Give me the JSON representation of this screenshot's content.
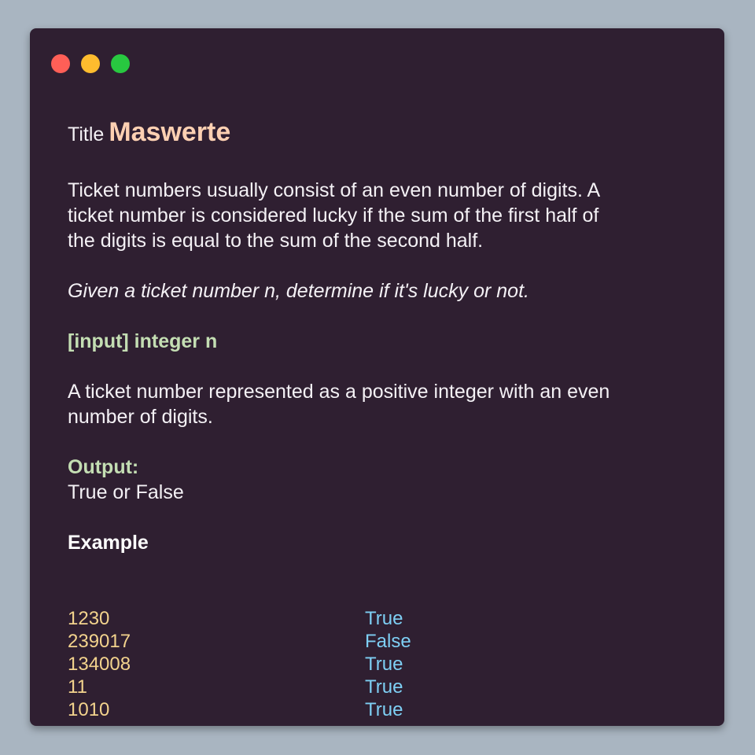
{
  "window": {
    "controls": {
      "close_color": "#ff5f57",
      "minimize_color": "#febc2e",
      "maximize_color": "#28c840"
    }
  },
  "content": {
    "title_prefix": "Title",
    "title_name": "Maswerte",
    "description": "Ticket numbers usually consist of an even number of digits. A ticket number is considered lucky if the sum of the first half of the digits is equal to the sum of the second half.",
    "task": "Given a ticket number n, determine if it's lucky or not.",
    "input_label": "[input] integer n",
    "input_description": "A ticket number represented as a positive integer with an even number of digits.",
    "output_label": "Output:",
    "output_description": "True or False",
    "example_label": "Example",
    "examples": [
      {
        "input": "1230",
        "output": "True"
      },
      {
        "input": "239017",
        "output": "False"
      },
      {
        "input": "134008",
        "output": "True"
      },
      {
        "input": "11",
        "output": "True"
      },
      {
        "input": "1010",
        "output": "True"
      }
    ]
  },
  "colors": {
    "background": "#a9b5c1",
    "window": "#2f1f31",
    "title_accent": "#fdd0b2",
    "label_green": "#c4deb3",
    "example_input": "#f3d38d",
    "example_output": "#7ecff4"
  }
}
